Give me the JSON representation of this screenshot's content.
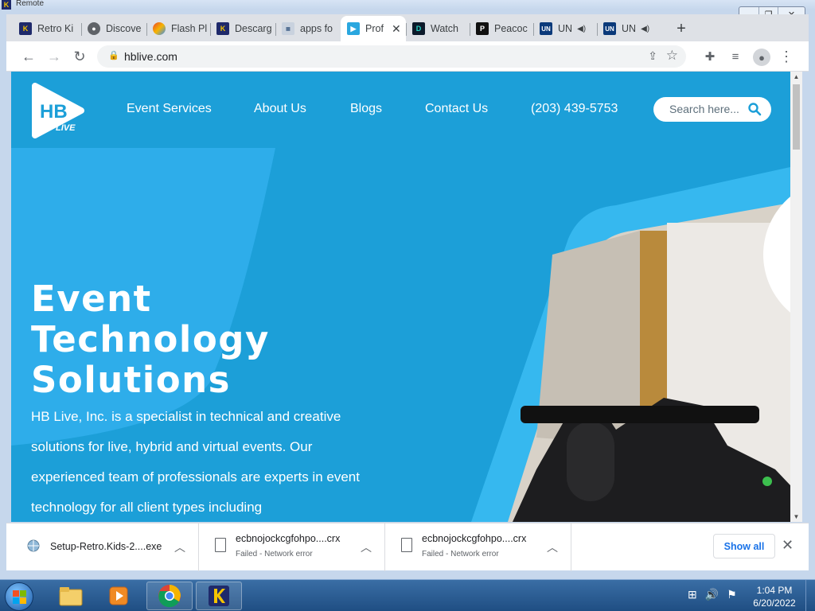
{
  "window": {
    "title": "Remote",
    "controls": [
      "minimize",
      "maximize",
      "close"
    ]
  },
  "tabs": [
    {
      "label": "Retro Ki",
      "favicon": "k-logo-icon"
    },
    {
      "label": "Discove",
      "favicon": "globe-icon"
    },
    {
      "label": "Flash Pl",
      "favicon": "flash-icon"
    },
    {
      "label": "Descarg",
      "favicon": "k-logo-icon"
    },
    {
      "label": "apps fo",
      "favicon": "apps-icon"
    },
    {
      "label": "Prof",
      "favicon": "hb-live-icon",
      "active": true
    },
    {
      "label": "Watch",
      "favicon": "tv-icon"
    },
    {
      "label": "Peacoc",
      "favicon": "peacock-icon"
    },
    {
      "label": "UN",
      "favicon": "un-icon",
      "audio": true
    },
    {
      "label": "UN",
      "favicon": "un-icon",
      "audio": true
    }
  ],
  "toolbar": {
    "url": "hblive.com"
  },
  "page": {
    "logo": {
      "letters": "HB",
      "sub": "LIVE"
    },
    "nav": [
      "Event Services",
      "About Us",
      "Blogs",
      "Contact Us",
      "(203) 439-5753"
    ],
    "search_placeholder": "Search here...",
    "hero_title": [
      "Event",
      "Technology",
      "Solutions"
    ],
    "hero_text": "HB Live, Inc. is a specialist in technical and creative solutions for live, hybrid and virtual events. Our experienced team of professionals are experts in event technology for all client types including",
    "colors": {
      "brand_blue": "#1c9fd8",
      "accent_light": "#36b8ef",
      "text": "#ffffff"
    }
  },
  "downloads": [
    {
      "name": "Setup-Retro.Kids-2....exe",
      "status": ""
    },
    {
      "name": "ecbnojockcgfohpo....crx",
      "status": "Failed - Network error"
    },
    {
      "name": "ecbnojockcgfohpo....crx",
      "status": "Failed - Network error"
    }
  ],
  "downloads_show_all": "Show all",
  "taskbar": {
    "time": "1:04 PM",
    "date": "6/20/2022",
    "items": [
      "explorer",
      "media-player",
      "chrome",
      "retro-kids"
    ]
  }
}
